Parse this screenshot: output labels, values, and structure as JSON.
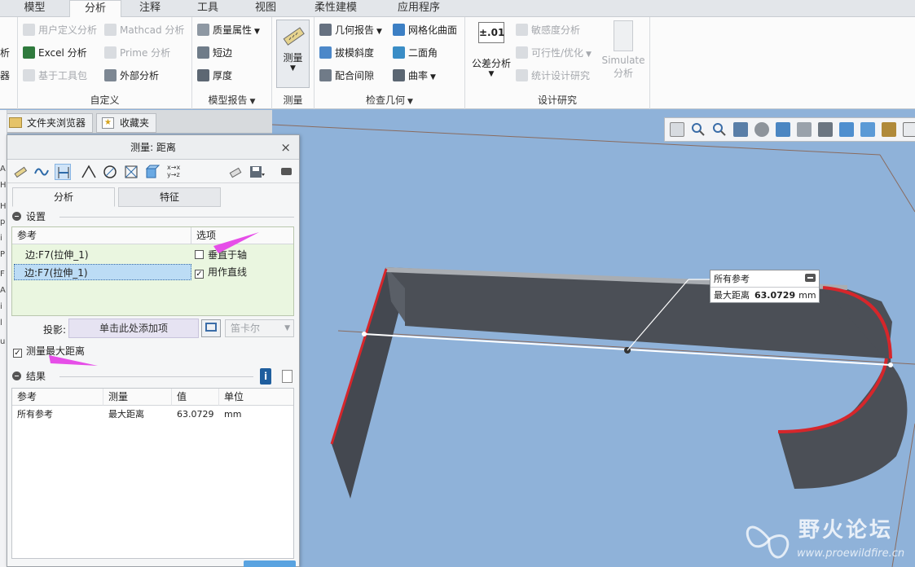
{
  "ribbon_tabs": [
    "模型",
    "分析",
    "注释",
    "工具",
    "视图",
    "柔性建模",
    "应用程序"
  ],
  "active_tab": "分析",
  "ribbon": {
    "left_cut": [
      "析",
      "器"
    ],
    "custom": {
      "title": "自定义",
      "items": [
        "用户定义分析",
        "Mathcad 分析",
        "Excel 分析",
        "Prime 分析",
        "基于工具包",
        "外部分析"
      ]
    },
    "model_report": {
      "title": "模型报告",
      "items": [
        "质量属性",
        "短边",
        "厚度"
      ]
    },
    "measure": {
      "title": "测量",
      "button": "测量"
    },
    "inspect_geometry": {
      "title": "检查几何",
      "items": [
        "几何报告",
        "网格化曲面",
        "拔模斜度",
        "二面角",
        "配合间隙",
        "曲率"
      ]
    },
    "design_study": {
      "title": "设计研究",
      "tolerance_icon": "±.01",
      "tolerance_label": "公差分析",
      "items": [
        "敏感度分析",
        "可行性/优化",
        "统计设计研究"
      ],
      "simulate": [
        "Simulate",
        "分析"
      ]
    }
  },
  "left_strip_chars": [
    "A",
    "H",
    "H",
    "p",
    "i",
    "P",
    "F",
    "A",
    "i",
    "l",
    "u"
  ],
  "navigator_tabs": [
    "文件夹浏览器",
    "收藏夹"
  ],
  "dialog": {
    "title": "测量: 距离",
    "close": "×",
    "tabs": [
      "分析",
      "特征"
    ],
    "settings_title": "设置",
    "ref_header": "参考",
    "options_header": "选项",
    "rows": [
      {
        "ref": "边:F7(拉伸_1)",
        "option": "垂直于轴",
        "checked": false
      },
      {
        "ref": "边:F7(拉伸_1)",
        "option": "用作直线",
        "checked": true
      }
    ],
    "projection_label": "投影:",
    "projection_field": "单击此处添加项",
    "projection_select": "笛卡尔",
    "measure_max_label": "测量最大距离",
    "measure_max_checked": true,
    "results_title": "结果",
    "results_headers": [
      "参考",
      "测量",
      "值",
      "单位"
    ],
    "results_rows": [
      [
        "所有参考",
        "最大距离",
        "63.0729",
        "mm"
      ]
    ]
  },
  "callout": {
    "title": "所有参考",
    "label": "最大距离",
    "value": "63.0729",
    "unit": "mm"
  },
  "watermark": {
    "text": "野火论坛",
    "url": "www.proewildfire.cn"
  },
  "colors": {
    "viewport": "#8fb2d9",
    "model": "#4b4f56",
    "highlight_edge": "#d6262b",
    "annotation_arrow": "#e64ee8"
  }
}
